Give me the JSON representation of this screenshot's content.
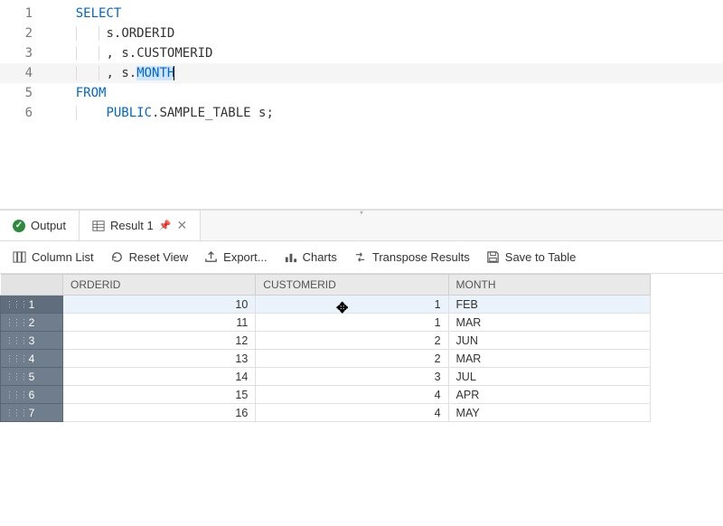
{
  "editor": {
    "lines": [
      {
        "num": "1",
        "indent": 0,
        "tokens": [
          {
            "cls": "kw",
            "t": "SELECT"
          }
        ]
      },
      {
        "num": "2",
        "indent": 2,
        "tokens": [
          {
            "cls": "plain",
            "t": "s"
          },
          {
            "cls": "punct",
            "t": "."
          },
          {
            "cls": "plain",
            "t": "ORDERID"
          }
        ]
      },
      {
        "num": "3",
        "indent": 2,
        "tokens": [
          {
            "cls": "punct",
            "t": ", "
          },
          {
            "cls": "plain",
            "t": "s"
          },
          {
            "cls": "punct",
            "t": "."
          },
          {
            "cls": "plain",
            "t": "CUSTOMERID"
          }
        ]
      },
      {
        "num": "4",
        "indent": 2,
        "tokens": [
          {
            "cls": "punct",
            "t": ", "
          },
          {
            "cls": "plain",
            "t": "s"
          },
          {
            "cls": "punct",
            "t": "."
          },
          {
            "cls": "id sel-hl",
            "t": "MONTH"
          }
        ],
        "cursor": true,
        "hl": true
      },
      {
        "num": "5",
        "indent": 0,
        "tokens": [
          {
            "cls": "kw",
            "t": "FROM"
          }
        ]
      },
      {
        "num": "6",
        "indent": 1,
        "tokens": [
          {
            "cls": "id",
            "t": "PUBLIC"
          },
          {
            "cls": "punct",
            "t": "."
          },
          {
            "cls": "plain",
            "t": "SAMPLE_TABLE s"
          },
          {
            "cls": "punct",
            "t": ";"
          }
        ]
      }
    ]
  },
  "tabs": {
    "output": "Output",
    "result": "Result 1"
  },
  "toolbar": {
    "columnList": "Column List",
    "resetView": "Reset View",
    "export": "Export...",
    "charts": "Charts",
    "transpose": "Transpose Results",
    "save": "Save to Table"
  },
  "grid": {
    "columns": [
      "ORDERID",
      "CUSTOMERID",
      "MONTH"
    ],
    "rows": [
      {
        "n": "1",
        "orderid": "10",
        "customerid": "1",
        "month": "FEB"
      },
      {
        "n": "2",
        "orderid": "11",
        "customerid": "1",
        "month": "MAR"
      },
      {
        "n": "3",
        "orderid": "12",
        "customerid": "2",
        "month": "JUN"
      },
      {
        "n": "4",
        "orderid": "13",
        "customerid": "2",
        "month": "MAR"
      },
      {
        "n": "5",
        "orderid": "14",
        "customerid": "3",
        "month": "JUL"
      },
      {
        "n": "6",
        "orderid": "15",
        "customerid": "4",
        "month": "APR"
      },
      {
        "n": "7",
        "orderid": "16",
        "customerid": "4",
        "month": "MAY"
      }
    ],
    "selectedRow": 0
  }
}
